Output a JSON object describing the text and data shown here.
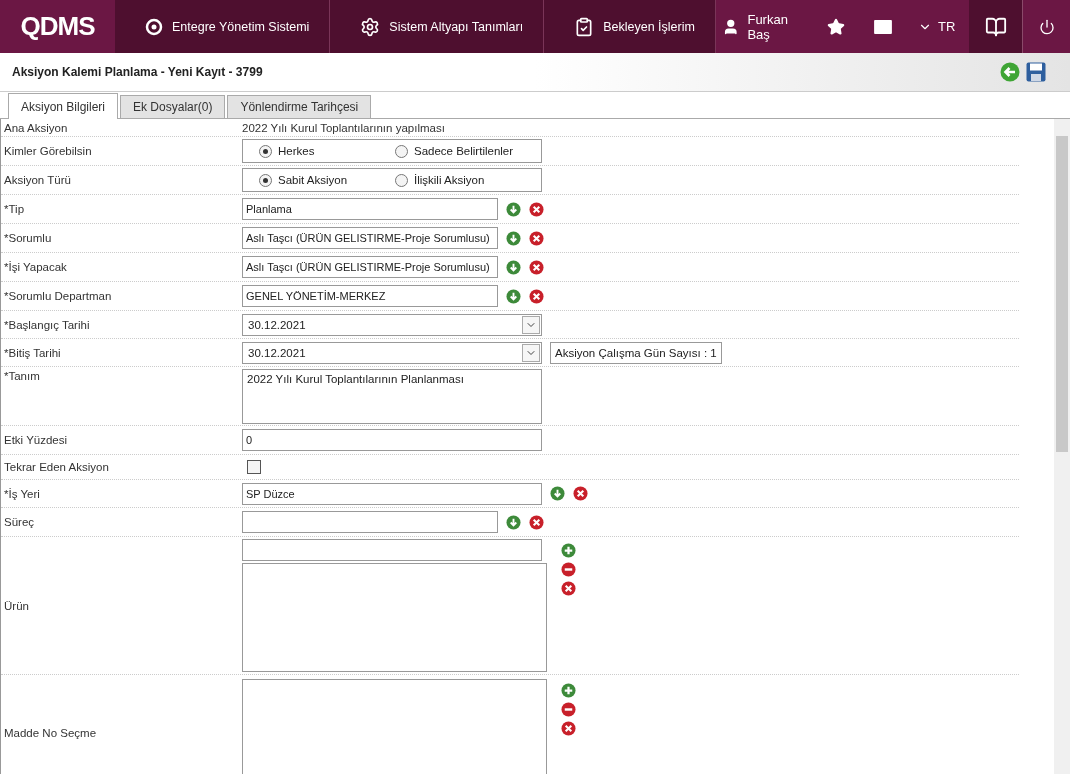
{
  "topbar": {
    "logo": "QDMS",
    "nav": [
      {
        "label": "Entegre Yönetim Sistemi"
      },
      {
        "label": "Sistem Altyapı Tanımları"
      },
      {
        "label": "Bekleyen İşlerim"
      }
    ],
    "user": "Furkan Baş",
    "language": "TR"
  },
  "header": {
    "title": "Aksiyon Kalemi Planlama - Yeni Kayıt - 3799"
  },
  "tabs": [
    {
      "label": "Aksiyon Bilgileri",
      "selected": true
    },
    {
      "label": "Ek Dosyalar(0)",
      "selected": false
    },
    {
      "label": "Yönlendirme Tarihçesi",
      "selected": false
    }
  ],
  "rows": [
    {
      "kind": "text",
      "label": "Ana Aksiyon",
      "value": "2022 Yılı Kurul Toplantılarının yapılması"
    },
    {
      "kind": "radio",
      "label": "Kimler Görebilsin",
      "options": [
        {
          "label": "Herkes",
          "selected": true
        },
        {
          "label": "Sadece Belirtilenler",
          "selected": false
        }
      ]
    },
    {
      "kind": "radio",
      "label": "Aksiyon Türü",
      "options": [
        {
          "label": "Sabit Aksiyon",
          "selected": true
        },
        {
          "label": "İlişkili Aksiyon",
          "selected": false
        }
      ]
    },
    {
      "kind": "lookup",
      "label": "*Tip",
      "value": "Planlama"
    },
    {
      "kind": "lookup",
      "label": "*Sorumlu",
      "value": "Aslı Taşcı (ÜRÜN GELISTIRME-Proje Sorumlusu)"
    },
    {
      "kind": "lookup",
      "label": "*İşi Yapacak",
      "value": "Aslı Taşcı (ÜRÜN GELISTIRME-Proje Sorumlusu)"
    },
    {
      "kind": "lookup",
      "label": "*Sorumlu Departman",
      "value": "GENEL YÖNETİM-MERKEZ"
    },
    {
      "kind": "date",
      "label": "*Başlangıç Tarihi",
      "value": "30.12.2021"
    },
    {
      "kind": "date",
      "label": "*Bitiş Tarihi",
      "value": "30.12.2021",
      "note": "Aksiyon Çalışma Gün Sayısı : 1"
    },
    {
      "kind": "textarea",
      "label": "*Tanım",
      "value": "2022 Yılı Kurul Toplantılarının Planlanması"
    },
    {
      "kind": "input",
      "label": "Etki Yüzdesi",
      "value": "0"
    },
    {
      "kind": "checkbox",
      "label": "Tekrar Eden Aksiyon",
      "checked": false
    },
    {
      "kind": "lookup_wide",
      "label": "*İş Yeri",
      "value": "SP Düzce"
    },
    {
      "kind": "lookup",
      "label": "Süreç"
    },
    {
      "kind": "picker",
      "label": "Ürün"
    },
    {
      "kind": "list",
      "label": "Madde No Seçme"
    }
  ]
}
